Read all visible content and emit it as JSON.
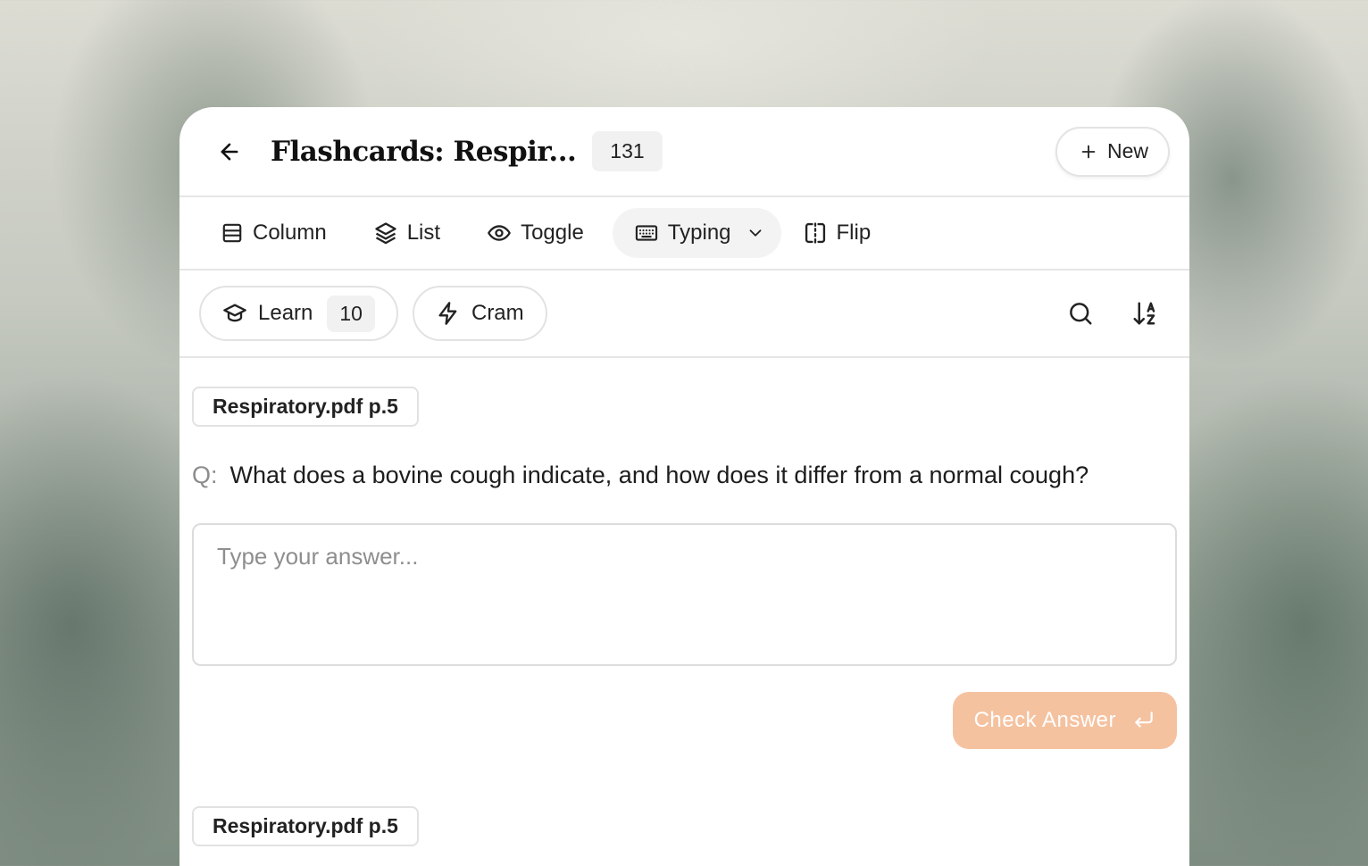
{
  "header": {
    "title": "Flashcards: Respir...",
    "card_count": "131",
    "new_label": "New"
  },
  "modes": [
    {
      "label": "Column",
      "icon": "table-icon"
    },
    {
      "label": "List",
      "icon": "layers-icon"
    },
    {
      "label": "Toggle",
      "icon": "eye-icon"
    },
    {
      "label": "Typing",
      "icon": "keyboard-icon",
      "active": true
    },
    {
      "label": "Flip",
      "icon": "flip-icon"
    }
  ],
  "actions": {
    "learn_label": "Learn",
    "learn_count": "10",
    "cram_label": "Cram"
  },
  "cards": [
    {
      "source": "Respiratory.pdf p.5",
      "question_prefix": "Q:",
      "question": "What does a bovine cough indicate, and how does it differ from a normal cough?",
      "answer_placeholder": "Type your answer...",
      "check_label": "Check Answer"
    },
    {
      "source": "Respiratory.pdf p.5"
    }
  ],
  "colors": {
    "accent": "#f5c2a0",
    "border": "#e2e2e2",
    "badge_bg": "#f1f1f1"
  }
}
